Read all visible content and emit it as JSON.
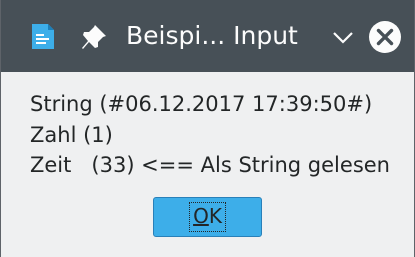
{
  "window": {
    "title": "Beispi... Input",
    "colors": {
      "titlebar": "#475057",
      "background": "#eff0f1",
      "button": "#3daee9",
      "close_circle": "#fcfcfc"
    },
    "icons": [
      "app-icon",
      "pin-icon",
      "chevron-down-icon",
      "close-icon"
    ]
  },
  "message": {
    "line1": "String (#06.12.2017 17:39:50#)",
    "line2": "Zahl (1)",
    "line3": "Zeit   (33) <== Als String gelesen"
  },
  "buttons": {
    "ok_mnemonic": "O",
    "ok_rest": "K"
  }
}
